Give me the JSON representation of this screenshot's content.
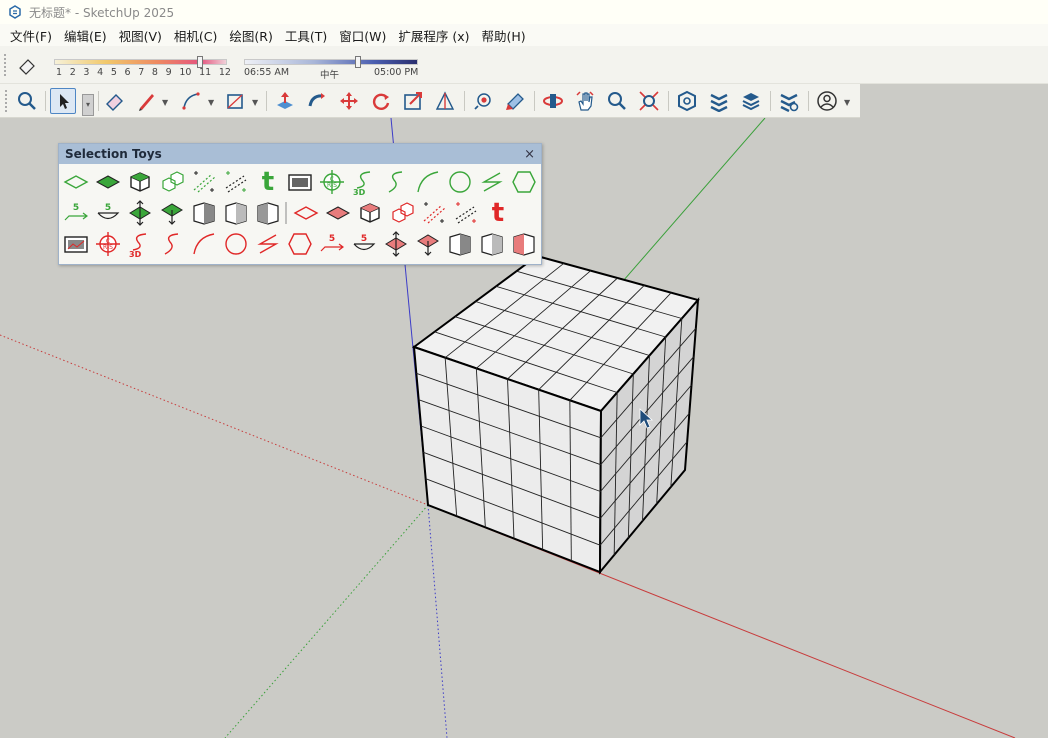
{
  "window": {
    "title": "无标题* - SketchUp 2025"
  },
  "menu": [
    {
      "label": "文件(F)"
    },
    {
      "label": "编辑(E)"
    },
    {
      "label": "视图(V)"
    },
    {
      "label": "相机(C)"
    },
    {
      "label": "绘图(R)"
    },
    {
      "label": "工具(T)"
    },
    {
      "label": "窗口(W)"
    },
    {
      "label": "扩展程序 (x)"
    },
    {
      "label": "帮助(H)"
    }
  ],
  "shadow": {
    "month_labels": [
      "1",
      "2",
      "3",
      "4",
      "5",
      "6",
      "7",
      "8",
      "9",
      "10",
      "11",
      "12"
    ],
    "time_start": "06:55 AM",
    "time_mid": "中午",
    "time_end": "05:00 PM"
  },
  "toolbar_icons": [
    "zoom-extents-icon",
    "select-arrow-icon",
    "eraser-icon",
    "pencil-line-icon",
    "arc-icon",
    "rectangle-icon",
    "push-pull-icon",
    "follow-me-icon",
    "move-icon",
    "rotate-icon",
    "scale-icon",
    "offset-icon",
    "paint-bucket-icon",
    "texture-icon",
    "orbit-icon",
    "pan-hand-icon",
    "zoom-icon",
    "zoom-window-icon",
    "extension-warehouse-icon",
    "layers-icon",
    "styles-icon",
    "preferences-icon",
    "account-icon"
  ],
  "selection_toys": {
    "title": "Selection Toys",
    "close": "×",
    "labels": {
      "t_green": "t",
      "t_red": "t",
      "num_5": "5",
      "threed_green": "3D",
      "threed_red": "3D"
    },
    "colors": {
      "select": "#3aa63a",
      "deselect": "#e02828"
    }
  },
  "colors": {
    "axis_red": "#c83c3c",
    "axis_green": "#3aa03a",
    "axis_blue": "#3c3cc8",
    "background": "#cbcbc6",
    "cube_face": "#eeeeee"
  }
}
